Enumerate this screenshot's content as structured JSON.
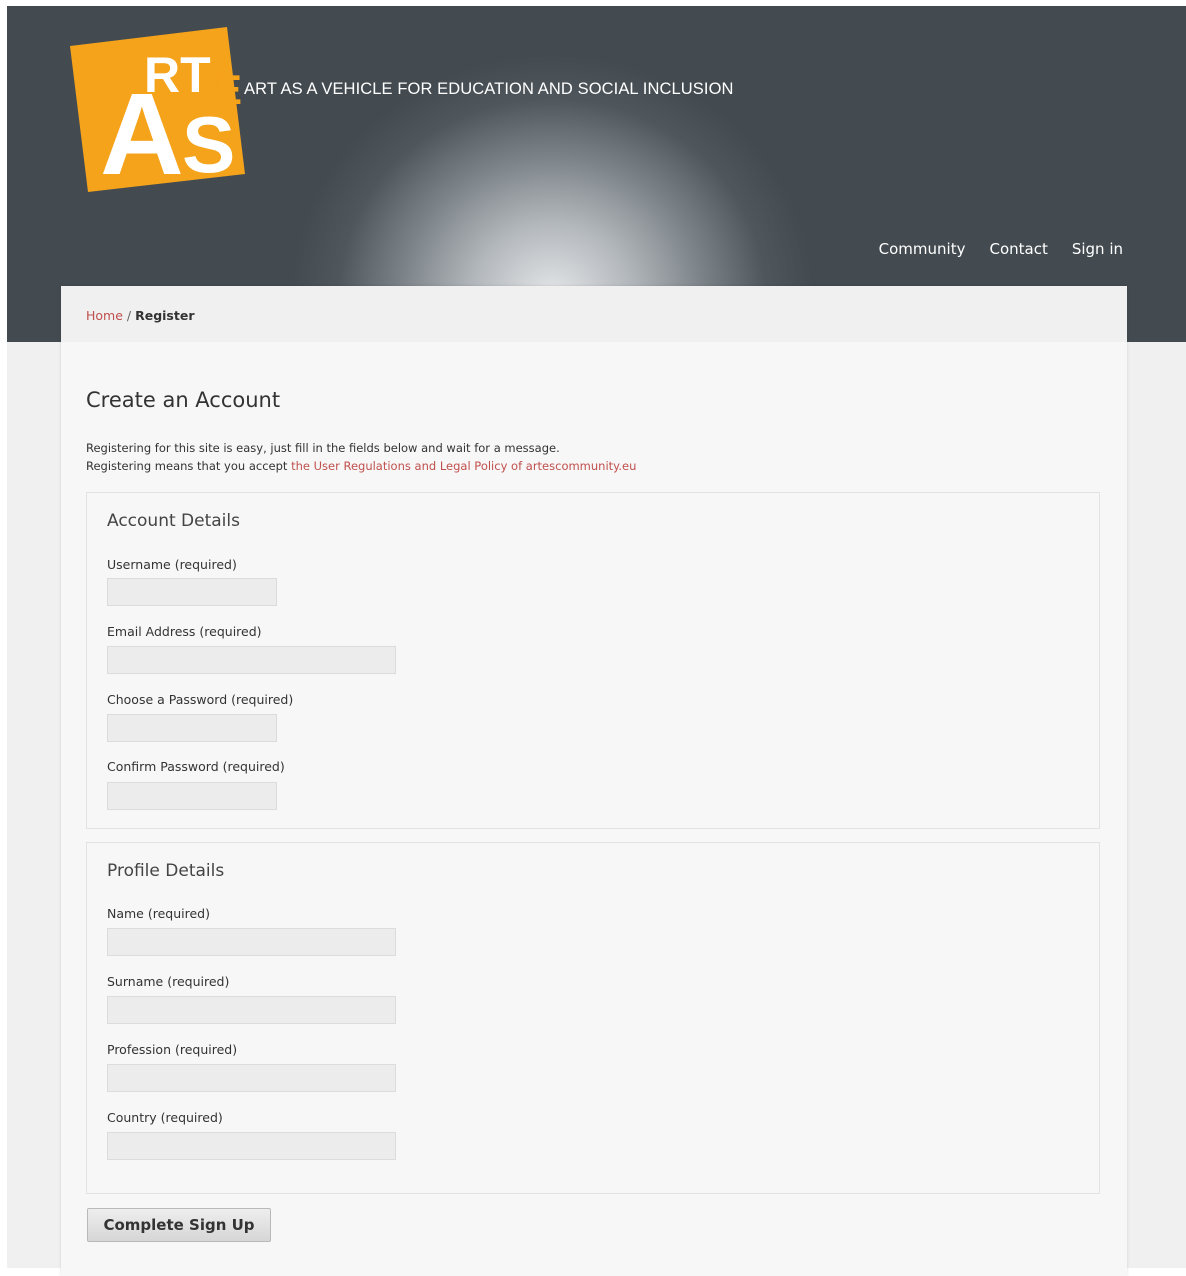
{
  "header": {
    "logo": {
      "letters": "ARTES"
    },
    "tagline": "ART AS A VEHICLE FOR EDUCATION AND SOCIAL INCLUSION",
    "nav": [
      {
        "label": "Community"
      },
      {
        "label": "Contact"
      },
      {
        "label": "Sign in"
      }
    ]
  },
  "breadcrumb": {
    "home": "Home",
    "separator": " / ",
    "current": "Register"
  },
  "page": {
    "title": "Create an Account",
    "intro_line1": "Registering for this site is easy, just fill in the fields below and wait for a message.",
    "intro_line2_prefix": "Registering means that you accept ",
    "intro_line2_link": "the User Regulations and Legal Policy of artescommunity.eu"
  },
  "account": {
    "title": "Account Details",
    "fields": [
      {
        "label": "Username (required)",
        "value": ""
      },
      {
        "label": "Email Address (required)",
        "value": ""
      },
      {
        "label": "Choose a Password (required)",
        "value": ""
      },
      {
        "label": "Confirm Password (required)",
        "value": ""
      }
    ]
  },
  "profile": {
    "title": "Profile Details",
    "fields": [
      {
        "label": "Name (required)",
        "value": ""
      },
      {
        "label": "Surname (required)",
        "value": ""
      },
      {
        "label": "Profession (required)",
        "value": ""
      },
      {
        "label": "Country (required)",
        "value": ""
      }
    ]
  },
  "submit_label": "Complete Sign Up",
  "colors": {
    "logo_orange": "#f5a31a",
    "link_red": "#c0504d",
    "header_dark": "#434b51"
  }
}
